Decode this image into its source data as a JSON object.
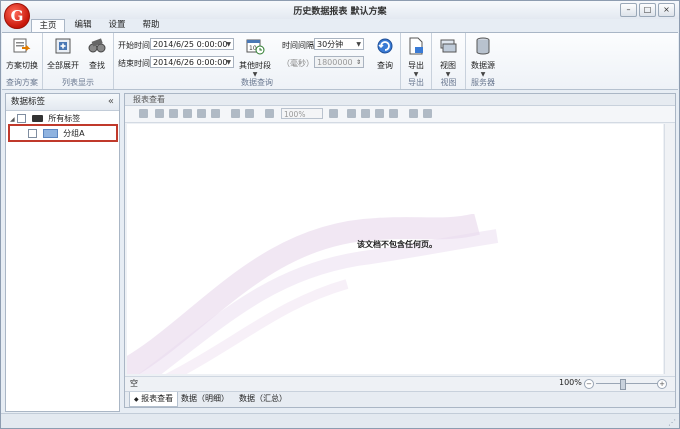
{
  "window": {
    "logo_letter": "G",
    "title": "历史数据报表 默认方案",
    "buttons": {
      "min": "–",
      "max": "□",
      "close": "×"
    }
  },
  "tabs": [
    {
      "label": "主页",
      "active": true
    },
    {
      "label": "编辑",
      "active": false
    },
    {
      "label": "设置",
      "active": false
    },
    {
      "label": "帮助",
      "active": false
    }
  ],
  "ribbon": {
    "scheme_switch": "方案切换",
    "expand_all": "全部展开",
    "find": "查找",
    "start_time_label": "开始时间",
    "start_time_value": "2014/6/25 0:00:00",
    "end_time_label": "结束时间",
    "end_time_value": "2014/6/26 0:00:00",
    "other_period": "其他时段",
    "interval_label": "时间间隔",
    "interval_value": "30分钟",
    "seconds_label": "（毫秒）",
    "seconds_value": "1800000",
    "query": "查询",
    "export": "导出",
    "view": "视图",
    "datasource": "数据源",
    "groups": {
      "scheme": "查询方案",
      "list": "列表显示",
      "data_query": "数据查询",
      "export": "导出",
      "view": "视图",
      "server": "服务器"
    }
  },
  "left_panel": {
    "header": "数据标签",
    "collapse": "«",
    "tree": {
      "root": "所有标签",
      "child": "分组A"
    }
  },
  "right_panel": {
    "header": "报表查看",
    "zoom_combo": "100%",
    "empty_message": "该文档不包含任何页。",
    "status_left": "空",
    "zoom_value": "100%",
    "bottom_tabs": [
      {
        "label": "报表查看",
        "active": true
      },
      {
        "label": "数据（明细）",
        "active": false
      },
      {
        "label": "数据（汇总）",
        "active": false
      }
    ]
  },
  "colors": {
    "accent_border": "#c0392b",
    "ribbon_bg": "#eef2f7"
  }
}
